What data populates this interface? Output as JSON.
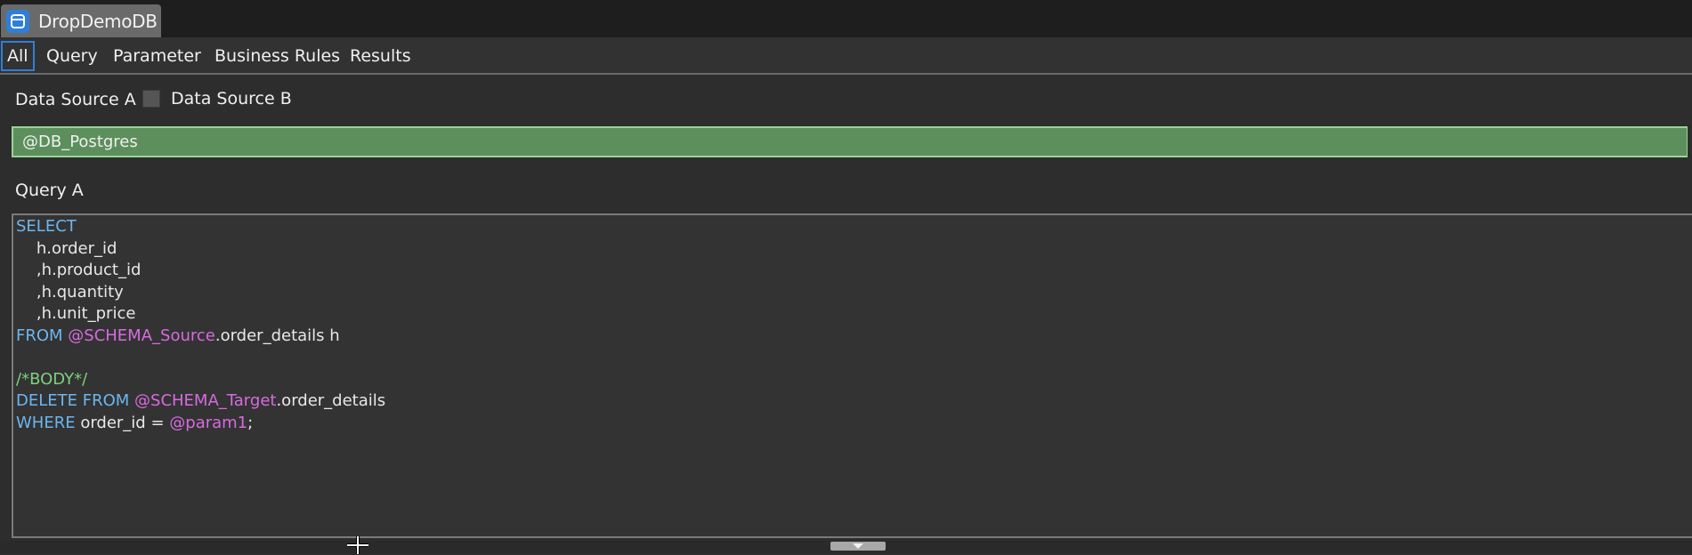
{
  "window": {
    "tab_title": "DropDemoDB",
    "icon": "database-app-icon"
  },
  "tabs": [
    {
      "label": "All",
      "active": true
    },
    {
      "label": "Query",
      "active": false
    },
    {
      "label": "Parameter",
      "active": false
    },
    {
      "label": "Business Rules",
      "active": false
    },
    {
      "label": "Results",
      "active": false
    }
  ],
  "data_source": {
    "label_a": "Data Source A",
    "label_b": "Data Source B",
    "checkbox_b_checked": false,
    "selected_connection": "@DB_Postgres"
  },
  "query": {
    "label": "Query A",
    "lines": [
      [
        {
          "t": "kw",
          "s": "SELECT"
        }
      ],
      [
        {
          "t": "txt",
          "s": "    h.order_id"
        }
      ],
      [
        {
          "t": "txt",
          "s": "    ,h.product_id"
        }
      ],
      [
        {
          "t": "txt",
          "s": "    ,h.quantity"
        }
      ],
      [
        {
          "t": "txt",
          "s": "    ,h.unit_price"
        }
      ],
      [
        {
          "t": "kw",
          "s": "FROM "
        },
        {
          "t": "var",
          "s": "@SCHEMA_Source"
        },
        {
          "t": "txt",
          "s": ".order_details h"
        }
      ],
      [],
      [
        {
          "t": "cmt",
          "s": "/*BODY*/"
        }
      ],
      [
        {
          "t": "kw",
          "s": "DELETE FROM "
        },
        {
          "t": "var",
          "s": "@SCHEMA_Target"
        },
        {
          "t": "txt",
          "s": ".order_details"
        }
      ],
      [
        {
          "t": "kw",
          "s": "WHERE "
        },
        {
          "t": "txt",
          "s": "order_id = "
        },
        {
          "t": "var",
          "s": "@param1"
        },
        {
          "t": "txt",
          "s": ";"
        }
      ]
    ]
  },
  "colors": {
    "accent": "#2f7fd6",
    "combo_bg": "#5c8f5c",
    "combo_border": "#98d498",
    "keyword": "#6cb6f0",
    "variable": "#d76be0",
    "comment": "#7fd07f"
  }
}
